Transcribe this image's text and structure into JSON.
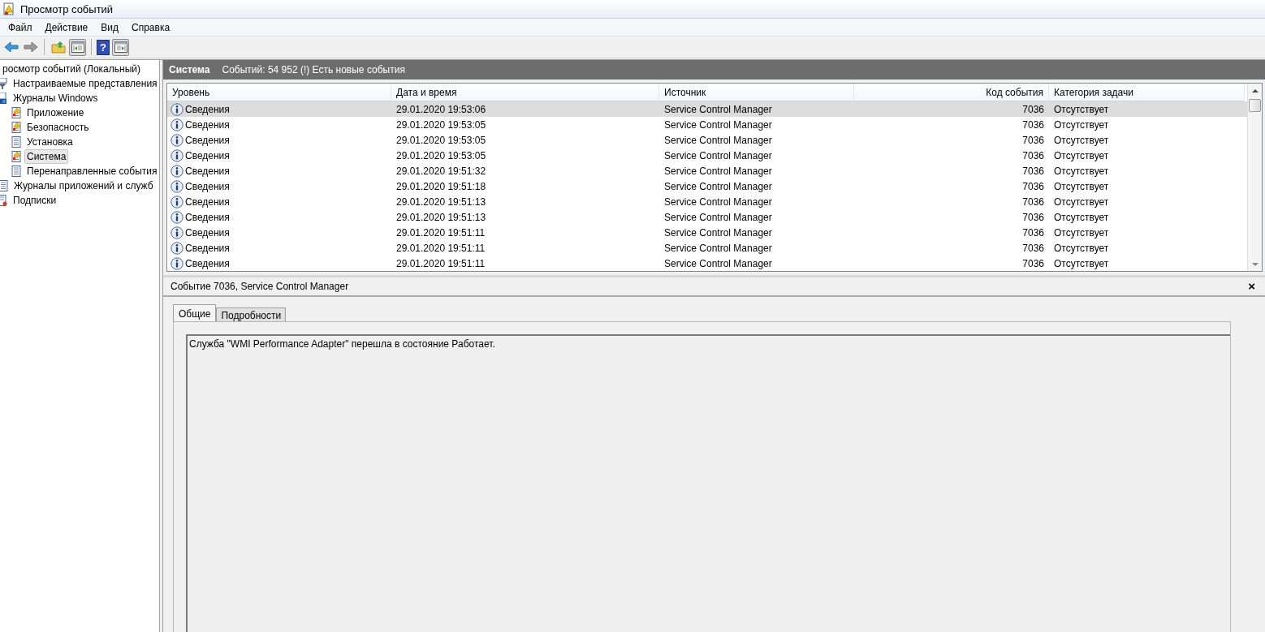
{
  "window": {
    "title": "Просмотр событий"
  },
  "menu": [
    "Файл",
    "Действие",
    "Вид",
    "Справка"
  ],
  "toolbar": {
    "help": "?"
  },
  "tree": [
    {
      "label": "росмотр событий (Локальный)",
      "selected": false,
      "children": [
        {
          "label": "Настраиваемые представления",
          "selected": false
        },
        {
          "label": "Журналы Windows",
          "selected": false,
          "children": [
            {
              "label": "Приложение",
              "selected": false
            },
            {
              "label": "Безопасность",
              "selected": false
            },
            {
              "label": "Установка",
              "selected": false
            },
            {
              "label": "Система",
              "selected": true
            },
            {
              "label": "Перенаправленные события",
              "selected": false
            }
          ]
        },
        {
          "label": "Журналы приложений и служб",
          "selected": false
        },
        {
          "label": "Подписки",
          "selected": false
        }
      ]
    }
  ],
  "log_header": {
    "title": "Система",
    "summary": "Событий: 54 952 (!) Есть новые события"
  },
  "table": {
    "columns": [
      "Уровень",
      "Дата и время",
      "Источник",
      "Код события",
      "Категория задачи"
    ],
    "rows": [
      {
        "level": "Сведения",
        "datetime": "29.01.2020 19:53:06",
        "source": "Service Control Manager",
        "event_id": "7036",
        "category": "Отсутствует",
        "selected": true
      },
      {
        "level": "Сведения",
        "datetime": "29.01.2020 19:53:05",
        "source": "Service Control Manager",
        "event_id": "7036",
        "category": "Отсутствует",
        "selected": false
      },
      {
        "level": "Сведения",
        "datetime": "29.01.2020 19:53:05",
        "source": "Service Control Manager",
        "event_id": "7036",
        "category": "Отсутствует",
        "selected": false
      },
      {
        "level": "Сведения",
        "datetime": "29.01.2020 19:53:05",
        "source": "Service Control Manager",
        "event_id": "7036",
        "category": "Отсутствует",
        "selected": false
      },
      {
        "level": "Сведения",
        "datetime": "29.01.2020 19:51:32",
        "source": "Service Control Manager",
        "event_id": "7036",
        "category": "Отсутствует",
        "selected": false
      },
      {
        "level": "Сведения",
        "datetime": "29.01.2020 19:51:18",
        "source": "Service Control Manager",
        "event_id": "7036",
        "category": "Отсутствует",
        "selected": false
      },
      {
        "level": "Сведения",
        "datetime": "29.01.2020 19:51:13",
        "source": "Service Control Manager",
        "event_id": "7036",
        "category": "Отсутствует",
        "selected": false
      },
      {
        "level": "Сведения",
        "datetime": "29.01.2020 19:51:13",
        "source": "Service Control Manager",
        "event_id": "7036",
        "category": "Отсутствует",
        "selected": false
      },
      {
        "level": "Сведения",
        "datetime": "29.01.2020 19:51:11",
        "source": "Service Control Manager",
        "event_id": "7036",
        "category": "Отсутствует",
        "selected": false
      },
      {
        "level": "Сведения",
        "datetime": "29.01.2020 19:51:11",
        "source": "Service Control Manager",
        "event_id": "7036",
        "category": "Отсутствует",
        "selected": false
      },
      {
        "level": "Сведения",
        "datetime": "29.01.2020 19:51:11",
        "source": "Service Control Manager",
        "event_id": "7036",
        "category": "Отсутствует",
        "selected": false
      }
    ]
  },
  "detail": {
    "title": "Событие 7036, Service Control Manager",
    "close": "×",
    "tabs": [
      {
        "label": "Общие",
        "selected": true
      },
      {
        "label": "Подробности",
        "selected": false
      }
    ],
    "message": "Служба \"WMI Performance Adapter\" перешла в состояние Работает."
  }
}
